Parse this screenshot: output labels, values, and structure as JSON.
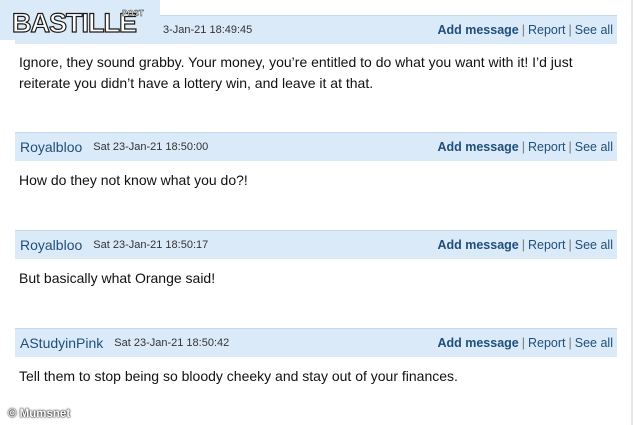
{
  "brand": {
    "logo_text": "BASTILLE",
    "logo_sub": "POST"
  },
  "watermark": "© Mumsnet",
  "actions": {
    "add": "Add message",
    "sep": "|",
    "report": "Report",
    "see_all": "See all"
  },
  "posts": [
    {
      "user": "",
      "date": "3-Jan-21 18:49:45",
      "body": "Ignore, they sound grabby. Your money, you’re entitled to do what you want with it! I’d just reiterate you didn’t have a lottery win, and leave it at that."
    },
    {
      "user": "Royalbloo",
      "date": "Sat 23-Jan-21 18:50:00",
      "body": "How do they not know what you do?!"
    },
    {
      "user": "Royalbloo",
      "date": "Sat 23-Jan-21 18:50:17",
      "body": "But basically what Orange said!"
    },
    {
      "user": "AStudyinPink",
      "date": "Sat 23-Jan-21 18:50:42",
      "body": "Tell them to stop being so bloody cheeky and stay out of your finances."
    }
  ]
}
